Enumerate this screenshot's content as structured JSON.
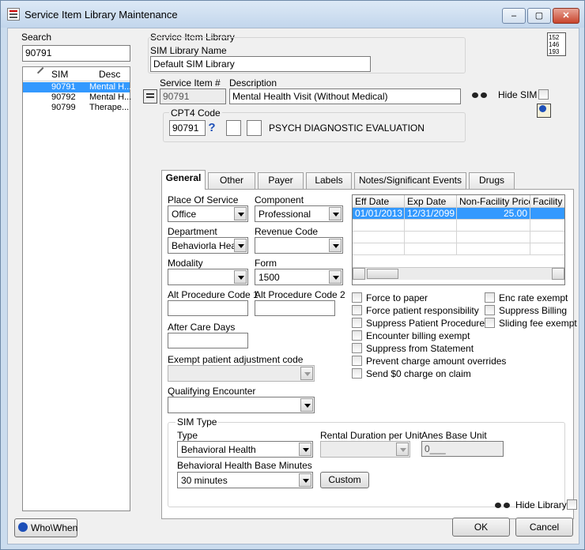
{
  "window": {
    "title": "Service Item Library Maintenance",
    "min": "‒",
    "max": "▢",
    "close": "✕"
  },
  "search": {
    "label": "Search",
    "value": "90791"
  },
  "list": {
    "headers": [
      "SIM",
      "Desc"
    ],
    "rows": [
      {
        "sim": "90791",
        "desc": "Mental H..."
      },
      {
        "sim": "90792",
        "desc": "Mental H..."
      },
      {
        "sim": "90799",
        "desc": "Therape..."
      }
    ]
  },
  "library": {
    "group_label": "Service Item Library",
    "name_label": "SIM Library Name",
    "name_value": "Default SIM Library"
  },
  "service_item": {
    "number_label": "Service Item #",
    "number_value": "90791",
    "desc_label": "Description",
    "desc_value": "Mental Health Visit (Without Medical)",
    "hide_sim_label": "Hide SIM"
  },
  "cpt4": {
    "label": "CPT4 Code",
    "value": "90791",
    "help": "?",
    "desc": "PSYCH DIAGNOSTIC EVALUATION"
  },
  "calendar_icon": {
    "lines": [
      "152",
      "146",
      "193"
    ]
  },
  "tabs": [
    {
      "label": "General"
    },
    {
      "label": "Other"
    },
    {
      "label": "Payer"
    },
    {
      "label": "Labels"
    },
    {
      "label": "Notes/Significant Events"
    },
    {
      "label": "Drugs"
    }
  ],
  "general": {
    "place_of_service": {
      "label": "Place Of Service",
      "value": "Office"
    },
    "component": {
      "label": "Component",
      "value": "Professional"
    },
    "department": {
      "label": "Department",
      "value": "Behaviorla Hea"
    },
    "revenue_code": {
      "label": "Revenue Code",
      "value": ""
    },
    "modality": {
      "label": "Modality",
      "value": ""
    },
    "form": {
      "label": "Form",
      "value": "1500"
    },
    "alt_proc_1": {
      "label": "Alt Procedure Code 1",
      "value": ""
    },
    "alt_proc_2": {
      "label": "Alt Procedure Code 2",
      "value": ""
    },
    "after_care": {
      "label": "After Care Days",
      "value": ""
    },
    "exempt_adj": {
      "label": "Exempt patient adjustment code",
      "value": ""
    },
    "qualifying": {
      "label": "Qualifying Encounter",
      "value": ""
    }
  },
  "fee_grid": {
    "headers": [
      "Eff Date",
      "Exp Date",
      "Non-Facility Price",
      "Facility P"
    ],
    "rows": [
      [
        "01/01/2013",
        "12/31/2099",
        "25.00",
        ""
      ]
    ]
  },
  "checks_left": [
    "Force to paper",
    "Force patient responsibility",
    "Suppress Patient Procedure",
    "Encounter billing exempt",
    "Suppress from Statement",
    "Prevent charge amount overrides",
    "Send $0 charge on claim"
  ],
  "checks_right": [
    "Enc rate exempt",
    "Suppress Billing",
    "Sliding fee exempt"
  ],
  "sim_type": {
    "group_label": "SIM Type",
    "type_label": "Type",
    "type_value": "Behavioral Health",
    "rental_label": "Rental Duration per Unit",
    "rental_value": "",
    "anes_label": "Anes Base Unit",
    "anes_value": "0___",
    "bh_label": "Behavioral Health Base Minutes",
    "bh_value": "30 minutes",
    "custom_button": "Custom"
  },
  "footer": {
    "hide_library": "Hide Library",
    "who_when": "Who\\When",
    "ok": "OK",
    "cancel": "Cancel"
  }
}
